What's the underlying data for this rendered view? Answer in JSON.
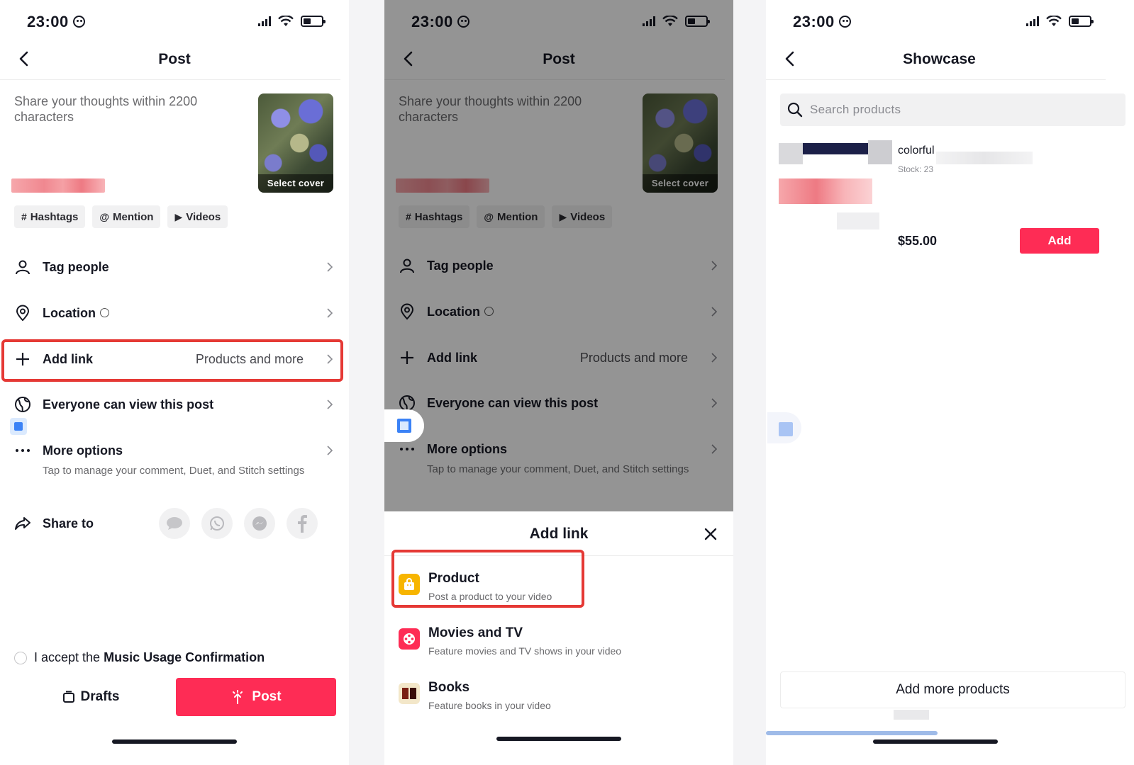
{
  "status_bar": {
    "time": "23:00"
  },
  "panel1": {
    "nav_title": "Post",
    "caption_placeholder": "Share your thoughts within 2200 characters",
    "cover_label": "Select cover",
    "chips": [
      {
        "glyph": "#",
        "label": "Hashtags"
      },
      {
        "glyph": "@",
        "label": "Mention"
      },
      {
        "glyph": "▶",
        "label": "Videos"
      }
    ],
    "rows": {
      "tag_people": "Tag people",
      "location": "Location",
      "add_link": "Add link",
      "add_link_right": "Products and more",
      "visibility": "Everyone can view this post",
      "more_options": "More options",
      "more_options_sub": "Tap to manage your comment, Duet, and Stitch settings",
      "share_to": "Share to"
    },
    "accept_prefix": "I accept the",
    "accept_link": "Music Usage Confirmation",
    "drafts_label": "Drafts",
    "post_label": "Post"
  },
  "panel2": {
    "sheet_title": "Add link",
    "options": [
      {
        "title": "Product",
        "subtitle": "Post a product to your video",
        "icon": "shopping-bag-icon",
        "color": "#f7b500"
      },
      {
        "title": "Movies and TV",
        "subtitle": "Feature movies and TV shows in your video",
        "icon": "film-reel-icon",
        "color": "#fe2c55"
      },
      {
        "title": "Books",
        "subtitle": "Feature books in your video",
        "icon": "book-icon",
        "color": "#7a3b1c"
      }
    ]
  },
  "panel3": {
    "nav_title": "Showcase",
    "search_placeholder": "Search products",
    "product": {
      "name": "colorful",
      "stock": "Stock: 23",
      "price": "$55.00",
      "add_label": "Add"
    },
    "add_more_label": "Add more products"
  },
  "colors": {
    "accent": "#fe2c55",
    "highlight": "#e53935",
    "text": "#161823"
  }
}
